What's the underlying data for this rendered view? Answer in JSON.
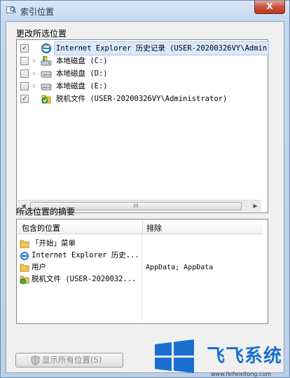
{
  "window": {
    "title": "索引位置",
    "close_label": "X"
  },
  "change_locations": {
    "label": "更改所选位置",
    "items": [
      {
        "label": "Internet Explorer 历史记录 (USER-20200326VY\\Admin",
        "checked": true,
        "icon": "ie-icon",
        "expandable": false
      },
      {
        "label": "本地磁盘 (C:)",
        "checked": false,
        "icon": "system-drive-icon",
        "expandable": true
      },
      {
        "label": "本地磁盘 (D:)",
        "checked": false,
        "icon": "drive-icon",
        "expandable": true
      },
      {
        "label": "本地磁盘 (E:)",
        "checked": false,
        "icon": "drive-icon",
        "expandable": true
      },
      {
        "label": "脱机文件 (USER-20200326VY\\Administrator)",
        "checked": true,
        "icon": "offline-files-icon",
        "expandable": false
      }
    ],
    "scroll_grip": "III"
  },
  "summary": {
    "label": "所选位置的摘要",
    "columns": {
      "included": "包含的位置",
      "excluded": "排除"
    },
    "rows": [
      {
        "included": "「开始」菜单",
        "icon": "folder-icon",
        "excluded": ""
      },
      {
        "included": "Internet Explorer 历史...",
        "icon": "ie-icon",
        "excluded": ""
      },
      {
        "included": "用户",
        "icon": "folder-icon",
        "excluded": "AppData; AppData"
      },
      {
        "included": "脱机文件 (USER-2020032...",
        "icon": "offline-files-icon",
        "excluded": ""
      }
    ]
  },
  "buttons": {
    "show_all": "显示所有位置(S)"
  },
  "watermark": {
    "brand": "飞飞系统",
    "url": "www.feifeixitong.com"
  },
  "colors": {
    "accent": "#1a6fd0",
    "close": "#c9513b"
  }
}
